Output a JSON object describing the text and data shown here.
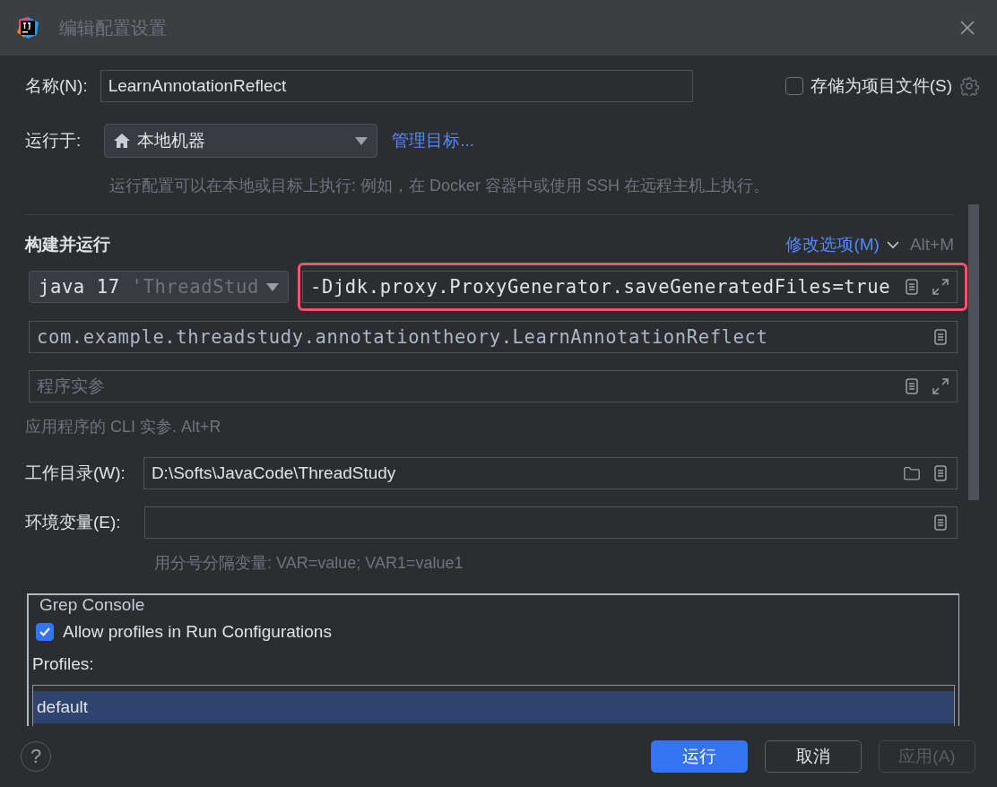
{
  "window": {
    "title": "编辑配置设置"
  },
  "name_field": {
    "label": "名称(N):",
    "value": "LearnAnnotationReflect"
  },
  "store_as_project_file": {
    "label": "存储为项目文件(S)",
    "checked": false
  },
  "run_on": {
    "label": "运行于:",
    "value": "本地机器",
    "link": "管理目标...",
    "hint": "运行配置可以在本地或目标上执行: 例如，在 Docker 容器中或使用 SSH 在远程主机上执行。"
  },
  "build_and_run": {
    "title": "构建并运行",
    "modify_options": "修改选项(M)",
    "shortcut": "Alt+M",
    "jdk": {
      "value": "java 17",
      "detail": "'ThreadStud"
    },
    "vm_options": {
      "value": "-Djdk.proxy.ProxyGenerator.saveGeneratedFiles=true",
      "highlighted": true
    },
    "main_class": {
      "value": "com.example.threadstudy.annotationtheory.LearnAnnotationReflect"
    },
    "program_args": {
      "placeholder": "程序实参",
      "hint": "应用程序的 CLI 实参. Alt+R"
    }
  },
  "working_dir": {
    "label": "工作目录(W):",
    "value": "D:\\Softs\\JavaCode\\ThreadStudy"
  },
  "env_vars": {
    "label": "环境变量(E):",
    "hint": "用分号分隔变量: VAR=value; VAR1=value1"
  },
  "grep_console": {
    "title": "Grep Console",
    "allow_profiles": {
      "label": "Allow profiles in Run Configurations",
      "checked": true
    },
    "profiles_label": "Profiles:",
    "profiles": [
      {
        "name": "default",
        "selected": true
      }
    ]
  },
  "help": "?",
  "buttons": [
    {
      "label": "运行",
      "kind": "primary",
      "disabled": false
    },
    {
      "label": "取消",
      "kind": "normal",
      "disabled": false
    },
    {
      "label": "应用(A)",
      "kind": "normal",
      "disabled": true
    }
  ]
}
